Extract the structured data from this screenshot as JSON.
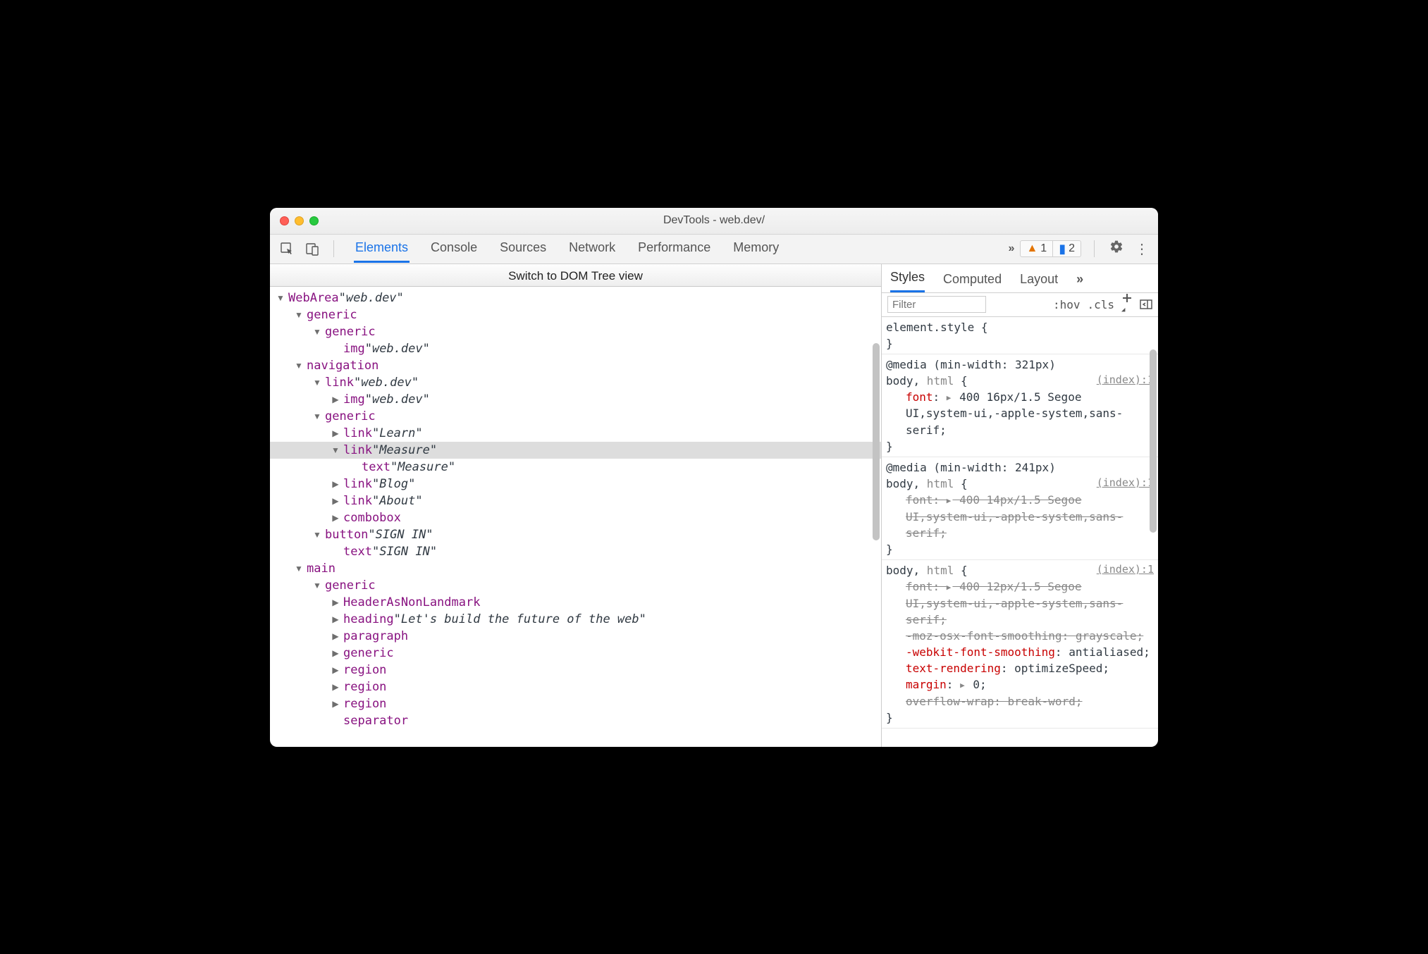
{
  "window": {
    "title": "DevTools - web.dev/"
  },
  "toolbar": {
    "tabs": [
      "Elements",
      "Console",
      "Sources",
      "Network",
      "Performance",
      "Memory"
    ],
    "active": "Elements",
    "overflow": "»",
    "warn_count": "1",
    "info_count": "2"
  },
  "switch_bar": "Switch to DOM Tree view",
  "tree": [
    {
      "d": 0,
      "a": "open",
      "role": "WebArea",
      "name": "web.dev"
    },
    {
      "d": 1,
      "a": "open",
      "role": "generic"
    },
    {
      "d": 2,
      "a": "open",
      "role": "generic"
    },
    {
      "d": 3,
      "a": "none",
      "role": "img",
      "name": "web.dev"
    },
    {
      "d": 1,
      "a": "open",
      "role": "navigation"
    },
    {
      "d": 2,
      "a": "open",
      "role": "link",
      "name": "web.dev"
    },
    {
      "d": 3,
      "a": "closed",
      "role": "img",
      "name": "web.dev"
    },
    {
      "d": 2,
      "a": "open",
      "role": "generic"
    },
    {
      "d": 3,
      "a": "closed",
      "role": "link",
      "name": "Learn"
    },
    {
      "d": 3,
      "a": "open",
      "role": "link",
      "name": "Measure",
      "sel": true
    },
    {
      "d": 4,
      "a": "none",
      "role": "text",
      "name": "Measure"
    },
    {
      "d": 3,
      "a": "closed",
      "role": "link",
      "name": "Blog"
    },
    {
      "d": 3,
      "a": "closed",
      "role": "link",
      "name": "About"
    },
    {
      "d": 3,
      "a": "closed",
      "role": "combobox"
    },
    {
      "d": 2,
      "a": "open",
      "role": "button",
      "name": "SIGN IN"
    },
    {
      "d": 3,
      "a": "none",
      "role": "text",
      "name": "SIGN IN"
    },
    {
      "d": 1,
      "a": "open",
      "role": "main"
    },
    {
      "d": 2,
      "a": "open",
      "role": "generic"
    },
    {
      "d": 3,
      "a": "closed",
      "role": "HeaderAsNonLandmark"
    },
    {
      "d": 3,
      "a": "closed",
      "role": "heading",
      "name": "Let's build the future of the web"
    },
    {
      "d": 3,
      "a": "closed",
      "role": "paragraph"
    },
    {
      "d": 3,
      "a": "closed",
      "role": "generic"
    },
    {
      "d": 3,
      "a": "closed",
      "role": "region"
    },
    {
      "d": 3,
      "a": "closed",
      "role": "region"
    },
    {
      "d": 3,
      "a": "closed",
      "role": "region"
    },
    {
      "d": 3,
      "a": "none",
      "role": "separator"
    }
  ],
  "styles": {
    "tabs": [
      "Styles",
      "Computed",
      "Layout"
    ],
    "active": "Styles",
    "overflow": "»",
    "filter_placeholder": "Filter",
    "hov": ":hov",
    "cls": ".cls",
    "element_style": "element.style {",
    "close_brace": "}",
    "src": "(index):1",
    "rules": [
      {
        "media": "@media (min-width: 321px)",
        "selector_main": "body,",
        "selector_dim": " html",
        "props": [
          {
            "n": "font",
            "v": "400 16px/1.5 Segoe UI,system-ui,-apple-system,sans-serif;",
            "tri": true
          }
        ]
      },
      {
        "media": "@media (min-width: 241px)",
        "selector_main": "body,",
        "selector_dim": " html",
        "props": [
          {
            "n": "font",
            "v": "400 14px/1.5 Segoe UI,system-ui,-apple-system,sans-serif;",
            "strike": true,
            "tri": true
          }
        ]
      },
      {
        "selector_main": "body,",
        "selector_dim": " html",
        "props": [
          {
            "n": "font",
            "v": "400 12px/1.5 Segoe UI,system-ui,-apple-system,sans-serif;",
            "strike": true,
            "tri": true
          },
          {
            "n": "-moz-osx-font-smoothing",
            "v": "grayscale;",
            "strike": true
          },
          {
            "n": "-webkit-font-smoothing",
            "v": "antialiased;"
          },
          {
            "n": "text-rendering",
            "v": "optimizeSpeed;"
          },
          {
            "n": "margin",
            "v": "0;",
            "tri": true
          },
          {
            "n": "overflow-wrap",
            "v": "break-word;",
            "strike": true
          }
        ]
      }
    ]
  }
}
